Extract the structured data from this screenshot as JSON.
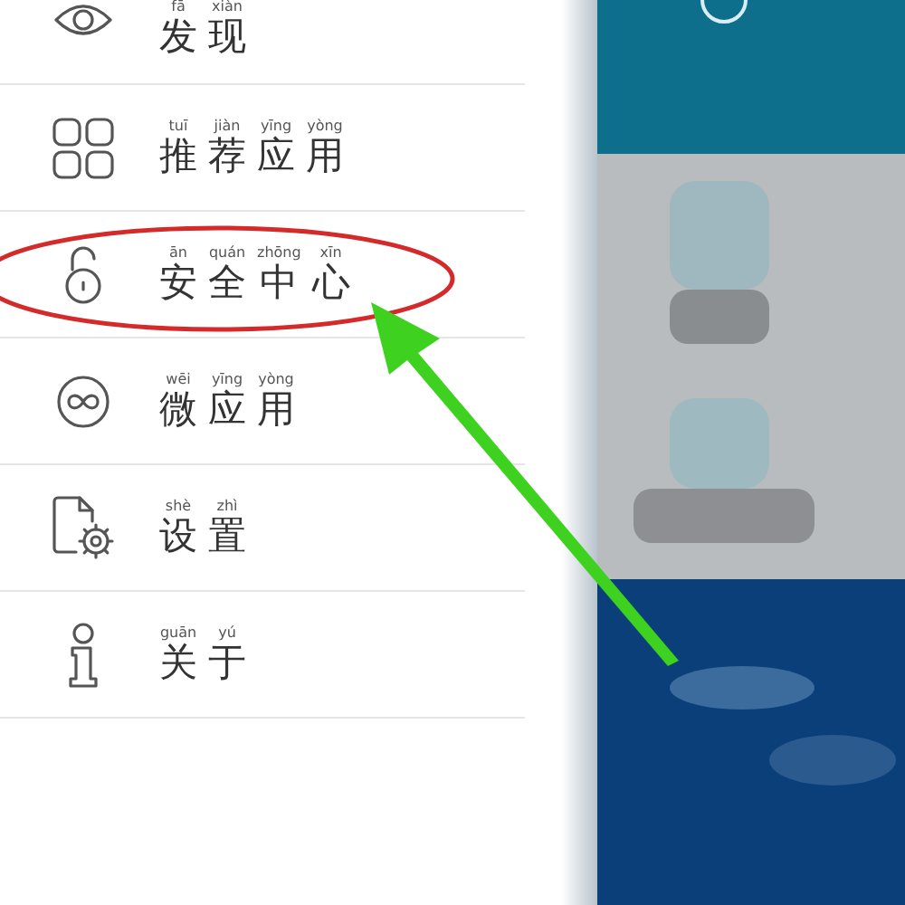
{
  "menu": [
    {
      "kind": "eye",
      "circled": false,
      "chars": [
        {
          "char": "发",
          "pinyin": "fā"
        },
        {
          "char": "现",
          "pinyin": "xiàn"
        }
      ]
    },
    {
      "kind": "grid",
      "circled": false,
      "chars": [
        {
          "char": "推",
          "pinyin": "tuī"
        },
        {
          "char": "荐",
          "pinyin": "jiàn"
        },
        {
          "char": "应",
          "pinyin": "yīng"
        },
        {
          "char": "用",
          "pinyin": "yòng"
        }
      ]
    },
    {
      "kind": "lock",
      "circled": true,
      "chars": [
        {
          "char": "安",
          "pinyin": "ān"
        },
        {
          "char": "全",
          "pinyin": "quán"
        },
        {
          "char": "中",
          "pinyin": "zhōng"
        },
        {
          "char": "心",
          "pinyin": "xīn"
        }
      ]
    },
    {
      "kind": "infinity",
      "circled": false,
      "chars": [
        {
          "char": "微",
          "pinyin": "wēi"
        },
        {
          "char": "应",
          "pinyin": "yīng"
        },
        {
          "char": "用",
          "pinyin": "yòng"
        }
      ]
    },
    {
      "kind": "file-gear",
      "circled": false,
      "chars": [
        {
          "char": "设",
          "pinyin": "shè"
        },
        {
          "char": "置",
          "pinyin": "zhì"
        }
      ]
    },
    {
      "kind": "info-person",
      "circled": false,
      "chars": [
        {
          "char": "关",
          "pinyin": "guān"
        },
        {
          "char": "于",
          "pinyin": "yú"
        }
      ]
    }
  ]
}
